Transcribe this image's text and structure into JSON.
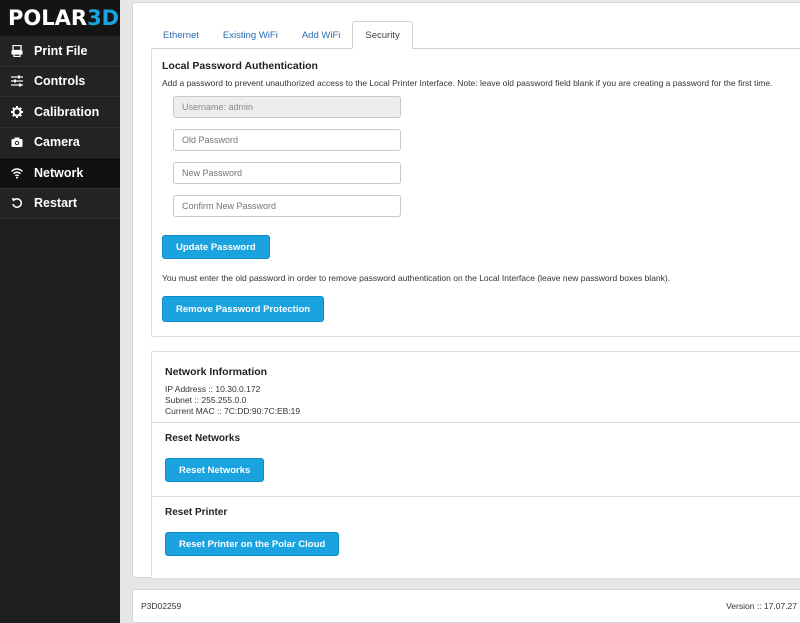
{
  "logo": {
    "part1": "POLAR",
    "part2": "3D"
  },
  "sidebar": {
    "items": [
      {
        "label": "Print File",
        "icon": "print-file-icon"
      },
      {
        "label": "Controls",
        "icon": "sliders-icon"
      },
      {
        "label": "Calibration",
        "icon": "gear-icon"
      },
      {
        "label": "Camera",
        "icon": "camera-icon"
      },
      {
        "label": "Network",
        "icon": "wifi-icon",
        "active": true
      },
      {
        "label": "Restart",
        "icon": "restart-icon"
      }
    ]
  },
  "tabs": [
    {
      "label": "Ethernet"
    },
    {
      "label": "Existing WiFi"
    },
    {
      "label": "Add WiFi"
    },
    {
      "label": "Security",
      "active": true
    }
  ],
  "password": {
    "title": "Local Password Authentication",
    "description": "Add a password to prevent unauthorized access to the Local Printer Interface. Note: leave old password field blank if you are creating a password for the first time.",
    "username_value": "Username: admin",
    "old_placeholder": "Old Password",
    "new_placeholder": "New Password",
    "confirm_placeholder": "Confirm New Password",
    "update_button": "Update Password",
    "remove_note": "You must enter the old password in order to remove password authentication on the Local Interface (leave new password boxes blank).",
    "remove_button": "Remove Password Protection"
  },
  "network": {
    "title": "Network Information",
    "ip": "IP Address :: 10.30.0.172",
    "subnet": "Subnet :: 255.255.0.0",
    "mac": "Current MAC :: 7C:DD:90:7C:EB:19",
    "reset_networks_title": "Reset Networks",
    "reset_networks_button": "Reset Networks",
    "reset_printer_title": "Reset Printer",
    "reset_printer_button": "Reset Printer on the Polar Cloud"
  },
  "footer": {
    "serial": "P3D02259",
    "version": "Version :: 17.07.27"
  },
  "colors": {
    "accent": "#1aa3df",
    "sidebar": "#1e1e1e",
    "link": "#2a6cb0"
  }
}
